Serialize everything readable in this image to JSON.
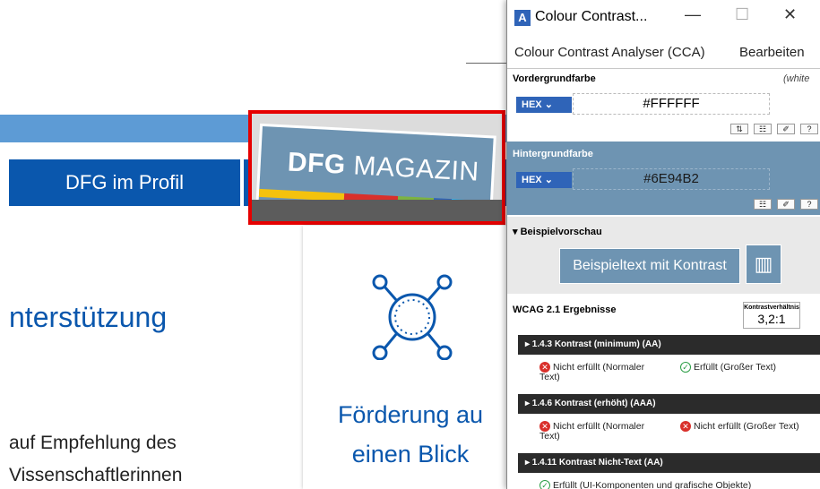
{
  "website": {
    "nav_item": "DFG im Profil",
    "magazine": {
      "brand_bold": "DFG",
      "brand_rest": "MAGAZIN"
    },
    "heading": "nterstützung",
    "card": {
      "line1": "Förderung au",
      "line2": "einen Blick"
    },
    "paragraph": {
      "line1": "auf Empfehlung des",
      "line2": "Vissenschaftlerinnen"
    }
  },
  "cca": {
    "title": "Colour Contrast...",
    "window_controls": {
      "minimize": "—",
      "maximize": "☐",
      "close": "✕"
    },
    "menu": [
      "Colour Contrast Analyser (CCA)",
      "Bearbeiten"
    ],
    "foreground": {
      "label": "Vordergrundfarbe",
      "name": "(white",
      "format": "HEX",
      "value": "#FFFFFF",
      "color": "#FFFFFF"
    },
    "background": {
      "label": "Hintergrundfarbe",
      "format": "HEX",
      "value": "#6E94B2",
      "color": "#6E94B2"
    },
    "preview": {
      "label": "▾ Beispielvorschau",
      "sample_text": "Beispieltext mit Kontrast"
    },
    "results": {
      "label": "WCAG 2.1 Ergebnisse",
      "ratio_label": "Kontrastverhältnis",
      "ratio_value": "3,2:1",
      "criteria": [
        {
          "title": "▸ 1.4.3 Kontrast (minimum) (AA)",
          "normal": {
            "status": "fail",
            "text_a": "Nicht erfüllt (Normaler",
            "text_b": "Text)"
          },
          "large": {
            "status": "pass",
            "text": "Erfüllt (Großer Text)"
          }
        },
        {
          "title": "▸ 1.4.6 Kontrast (erhöht) (AAA)",
          "normal": {
            "status": "fail",
            "text_a": "Nicht erfüllt (Normaler",
            "text_b": "Text)"
          },
          "large": {
            "status": "fail",
            "text": "Nicht erfüllt (Großer Text)"
          }
        },
        {
          "title": "▸ 1.4.11 Kontrast Nicht-Text (AA)",
          "ui": {
            "status": "pass",
            "text": "Erfüllt (UI-Komponenten und grafische Objekte)"
          }
        }
      ]
    }
  },
  "colors": {
    "nav_blue": "#0A57AD",
    "band_blue": "#5D9BD5",
    "highlight_red": "#E60000",
    "cca_accent": "#2F64B8",
    "fail_red": "#D9302B",
    "pass_green": "#2A9D44"
  }
}
